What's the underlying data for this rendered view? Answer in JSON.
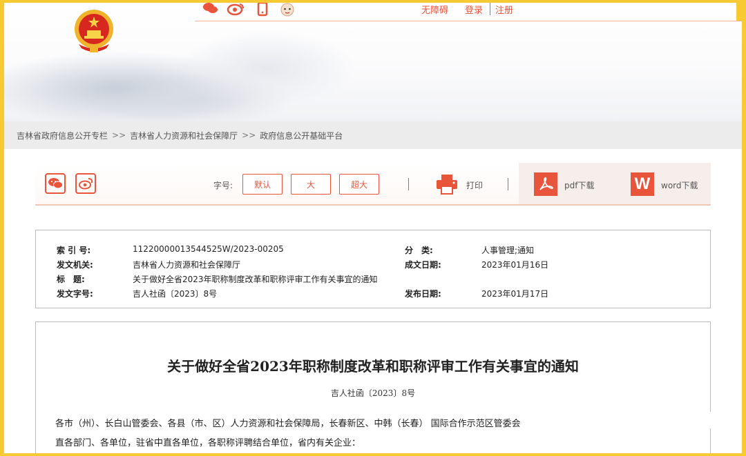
{
  "header": {
    "links": {
      "accessibility": "无障碍",
      "login": "登录",
      "register": "注册"
    }
  },
  "breadcrumb": {
    "items": [
      "吉林省政府信息公开专栏",
      "吉林省人力资源和社会保障厅",
      "政府信息公开基础平台"
    ],
    "separator": ">>"
  },
  "toolbar": {
    "font_size_label": "字号:",
    "sizes": [
      "默认",
      "大",
      "超大"
    ],
    "print": "打印",
    "pdf_download": "pdf下载",
    "word_download": "word下载",
    "word_icon_letter": "W"
  },
  "meta": {
    "index_label": "索 引 号:",
    "index_value": "11220000013544525W/2023-00205",
    "category_label": "分　类:",
    "category_value": "人事管理;通知",
    "issuer_label": "发文机关:",
    "issuer_value": "吉林省人力资源和社会保障厅",
    "created_label": "成文日期:",
    "created_value": "2023年01月16日",
    "title_label": "标　题:",
    "title_value": "关于做好全省2023年职称制度改革和职称评审工作有关事宜的通知",
    "docno_label": "发文字号:",
    "docno_value": "吉人社函〔2023〕8号",
    "published_label": "发布日期:",
    "published_value": "2023年01月17日"
  },
  "article": {
    "title": "关于做好全省2023年职称制度改革和职称评审工作有关事宜的通知",
    "doc_number": "吉人社函〔2023〕8号",
    "para1": "各市（州）、长白山管委会、各县（市、区）人力资源和社会保障局，长春新区、中韩（长春） 国际合作示范区管委会",
    "para2": "直各部门、各单位，驻省中直各单位，各职称评聘结合单位，省内有关企业："
  },
  "colors": {
    "accent": "#e8553a",
    "frame": "#f7c932",
    "breadcrumb_bg": "#ececec"
  }
}
